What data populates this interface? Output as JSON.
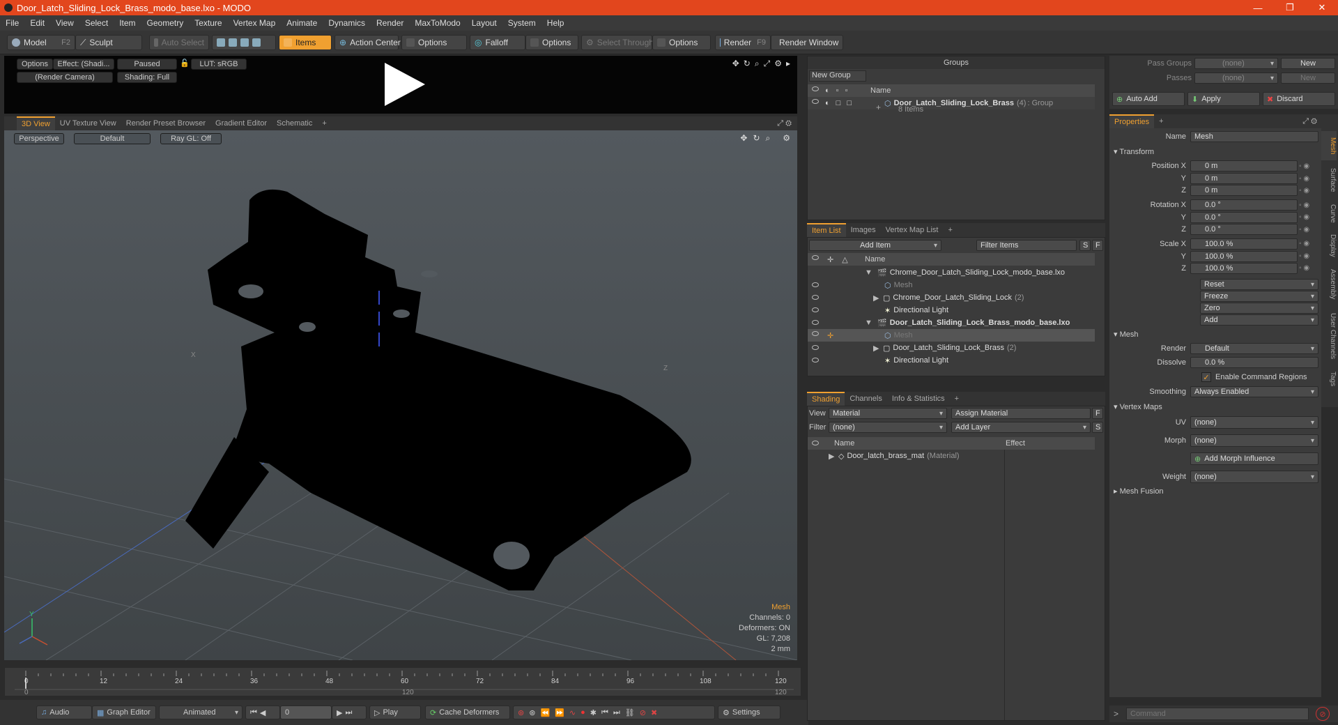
{
  "app": {
    "title": "Door_Latch_Sliding_Lock_Brass_modo_base.lxo - MODO",
    "menu": [
      "File",
      "Edit",
      "View",
      "Select",
      "Item",
      "Geometry",
      "Texture",
      "Vertex Map",
      "Animate",
      "Dynamics",
      "Render",
      "MaxToModo",
      "Layout",
      "System",
      "Help"
    ]
  },
  "toolbar": {
    "model": "Model",
    "model_key": "F2",
    "sculpt": "Sculpt",
    "auto_select": "Auto Select",
    "items": "Items",
    "action_center": "Action Center",
    "options1": "Options",
    "falloff": "Falloff",
    "options2": "Options",
    "select_through": "Select Through",
    "options3": "Options",
    "render": "Render",
    "render_key": "F9",
    "render_window": "Render Window"
  },
  "preview": {
    "options": "Options",
    "effect": "Effect: (Shadi...",
    "paused": "Paused",
    "lut": "LUT: sRGB",
    "camera": "(Render Camera)",
    "shading": "Shading: Full"
  },
  "viewport_tabs": [
    "3D View",
    "UV Texture View",
    "Render Preset Browser",
    "Gradient Editor",
    "Schematic",
    "+"
  ],
  "viewport": {
    "perspective": "Perspective",
    "default": "Default",
    "raygl": "Ray GL: Off",
    "axis_x": "X",
    "axis_z": "Z",
    "gizmo_y": "Y",
    "info": {
      "name": "Mesh",
      "channels": "Channels: 0",
      "deformers": "Deformers: ON",
      "gl": "GL: 7,208",
      "size": "2 mm"
    }
  },
  "timeline": {
    "ticks": [
      "0",
      "12",
      "24",
      "36",
      "48",
      "60",
      "72",
      "84",
      "96",
      "108",
      "120"
    ],
    "sub_ticks": [
      "0",
      "120",
      "120"
    ]
  },
  "bottombar": {
    "audio": "Audio",
    "graph_editor": "Graph Editor",
    "animated": "Animated",
    "frame": "0",
    "play": "Play",
    "cache": "Cache Deformers",
    "settings": "Settings"
  },
  "groups": {
    "title": "Groups",
    "new_group": "New Group",
    "col_name": "Name",
    "item_name": "Door_Latch_Sliding_Lock_Brass",
    "item_count": "(4)",
    "item_type": ": Group",
    "item_sub": "8 Items"
  },
  "itemlist": {
    "tabs": [
      "Item List",
      "Images",
      "Vertex Map List",
      "+"
    ],
    "add_item": "Add Item",
    "filter": "Filter Items",
    "s": "S",
    "f": "F",
    "col_name": "Name",
    "rows": [
      {
        "label": "Chrome_Door_Latch_Sliding_Lock_modo_base.lxo",
        "suffix": ""
      },
      {
        "label": "Mesh",
        "suffix": ""
      },
      {
        "label": "Chrome_Door_Latch_Sliding_Lock",
        "suffix": "(2)"
      },
      {
        "label": "Directional Light",
        "suffix": ""
      },
      {
        "label": "Door_Latch_Sliding_Lock_Brass_modo_base.lxo",
        "suffix": ""
      },
      {
        "label": "Mesh",
        "suffix": ""
      },
      {
        "label": "Door_Latch_Sliding_Lock_Brass",
        "suffix": "(2)"
      },
      {
        "label": "Directional Light",
        "suffix": ""
      }
    ]
  },
  "shading": {
    "tabs": [
      "Shading",
      "Channels",
      "Info & Statistics",
      "+"
    ],
    "view_label": "View",
    "view_value": "Material",
    "assign": "Assign Material",
    "f": "F",
    "filter_label": "Filter",
    "filter_value": "(none)",
    "add_layer": "Add Layer",
    "s": "S",
    "col_name": "Name",
    "col_effect": "Effect",
    "row_name": "Door_latch_brass_mat",
    "row_type": "(Material)"
  },
  "passes": {
    "pass_groups": "Pass Groups",
    "passes": "Passes",
    "none1": "(none)",
    "none2": "(none)",
    "new1": "New",
    "new2": "New",
    "auto_add": "Auto Add",
    "apply": "Apply",
    "discard": "Discard"
  },
  "properties": {
    "tab": "Properties",
    "plus": "+",
    "name_label": "Name",
    "name_value": "Mesh",
    "transform": "Transform",
    "pos_x_label": "Position X",
    "y": "Y",
    "z": "Z",
    "pos": [
      "0 m",
      "0 m",
      "0 m"
    ],
    "rot_x_label": "Rotation X",
    "rot": [
      "0.0 °",
      "0.0 °",
      "0.0 °"
    ],
    "scale_x_label": "Scale X",
    "scale": [
      "100.0 %",
      "100.0 %",
      "100.0 %"
    ],
    "buttons": [
      "Reset",
      "Freeze",
      "Zero",
      "Add"
    ],
    "mesh_section": "Mesh",
    "render_label": "Render",
    "render_value": "Default",
    "dissolve_label": "Dissolve",
    "dissolve_value": "0.0 %",
    "enable_cmd": "Enable Command Regions",
    "smoothing_label": "Smoothing",
    "smoothing_value": "Always Enabled",
    "vmaps": "Vertex Maps",
    "uv_label": "UV",
    "uv_value": "(none)",
    "morph_label": "Morph",
    "morph_value": "(none)",
    "add_morph": "Add Morph Influence",
    "weight_label": "Weight",
    "weight_value": "(none)",
    "mesh_fusion": "Mesh Fusion",
    "side_tabs": [
      "Mesh",
      "Surface",
      "Curve",
      "Display",
      "Assembly",
      "User Channels",
      "Tags"
    ],
    "command_placeholder": "Command"
  }
}
